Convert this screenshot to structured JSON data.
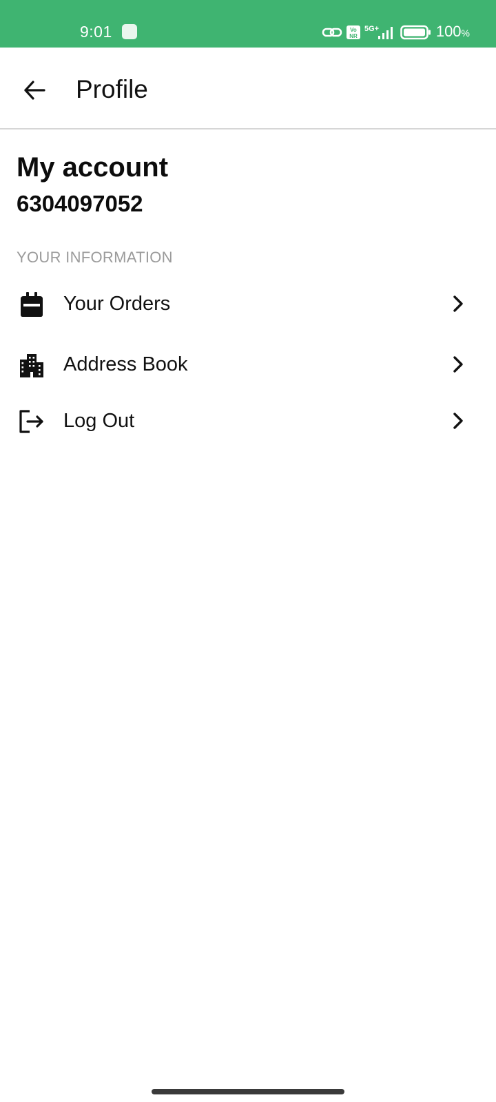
{
  "status_bar": {
    "time": "9:01",
    "network_label": "5G+",
    "volte_label": "Vo NR",
    "battery_percent": "100",
    "battery_unit": "%",
    "battery_level": 1.0,
    "background_color": "#3fb471",
    "icons": [
      "notification-app-icon",
      "link-icon",
      "volte-icon",
      "signal-icon",
      "battery-icon"
    ]
  },
  "app_bar": {
    "title": "Profile",
    "back_icon": "arrow-left-icon"
  },
  "account": {
    "heading": "My account",
    "phone": "6304097052"
  },
  "section": {
    "heading": "YOUR INFORMATION"
  },
  "menu": {
    "items": [
      {
        "label": "Your Orders",
        "icon": "bag-icon"
      },
      {
        "label": "Address Book",
        "icon": "building-icon"
      },
      {
        "label": "Log Out",
        "icon": "logout-icon"
      }
    ],
    "trailing_icon": "chevron-right-icon"
  }
}
